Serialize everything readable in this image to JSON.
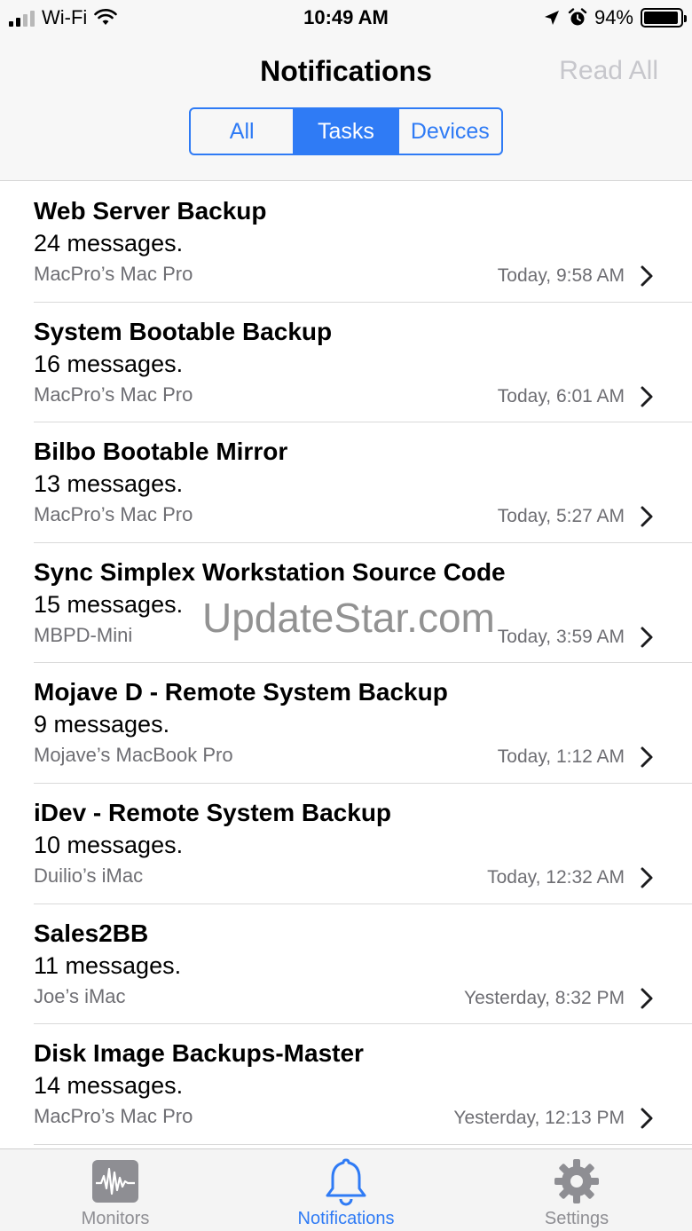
{
  "status_bar": {
    "carrier": "Wi-Fi",
    "time": "10:49 AM",
    "battery": "94%",
    "battery_level": 0.94
  },
  "nav": {
    "title": "Notifications",
    "read_all": "Read All",
    "segments": [
      "All",
      "Tasks",
      "Devices"
    ],
    "selected_segment": "Tasks"
  },
  "notifications": [
    {
      "title": "Web Server Backup",
      "count": "24 messages.",
      "device": "MacPro’s Mac Pro",
      "time": "Today, 9:58 AM"
    },
    {
      "title": "System Bootable Backup",
      "count": "16 messages.",
      "device": "MacPro’s Mac Pro",
      "time": "Today, 6:01 AM"
    },
    {
      "title": "Bilbo Bootable Mirror",
      "count": "13 messages.",
      "device": "MacPro’s Mac Pro",
      "time": "Today, 5:27 AM"
    },
    {
      "title": "Sync Simplex Workstation Source Code",
      "count": "15 messages.",
      "device": "MBPD-Mini",
      "time": "Today, 3:59 AM"
    },
    {
      "title": "Mojave D - Remote System Backup",
      "count": "9 messages.",
      "device": "Mojave’s MacBook Pro",
      "time": "Today, 1:12 AM"
    },
    {
      "title": "iDev - Remote System Backup",
      "count": "10 messages.",
      "device": "Duilio’s iMac",
      "time": "Today, 12:32 AM"
    },
    {
      "title": "Sales2BB",
      "count": "11 messages.",
      "device": "Joe’s iMac",
      "time": "Yesterday, 8:32 PM"
    },
    {
      "title": "Disk Image Backups-Master",
      "count": "14 messages.",
      "device": "MacPro’s Mac Pro",
      "time": "Yesterday, 12:13 PM"
    }
  ],
  "watermark": "UpdateStar.com",
  "tabbar": {
    "tabs": [
      {
        "label": "Monitors",
        "icon": "waveform-icon"
      },
      {
        "label": "Notifications",
        "icon": "bell-icon"
      },
      {
        "label": "Settings",
        "icon": "gear-icon"
      }
    ],
    "selected": "Notifications"
  },
  "colors": {
    "accent": "#2f7bf5",
    "secondary_text": "#6e6e73",
    "disabled": "#c7c7cc",
    "bar_background": "#f7f7f7"
  }
}
